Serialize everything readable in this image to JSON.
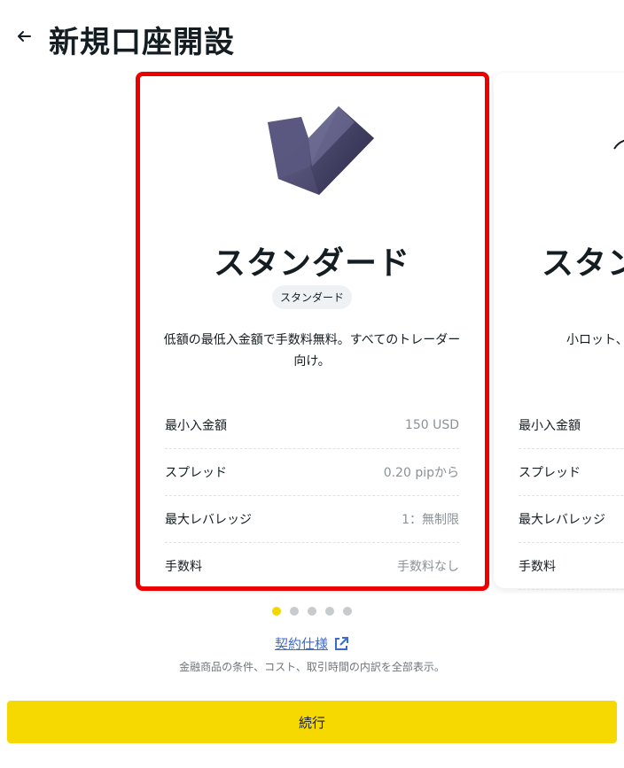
{
  "header": {
    "title": "新規口座開設",
    "back_icon": "arrow-left-icon"
  },
  "carousel": {
    "active_index": 0,
    "dot_count": 5,
    "cards": [
      {
        "title": "スタンダード",
        "badge": "スタンダード",
        "description": "低額の最低入金額で手数料無料。すべてのトレーダー向け。",
        "image": "standard-account-icon",
        "specs": [
          {
            "label": "最小入金額",
            "value": "150 USD"
          },
          {
            "label": "スプレッド",
            "value": "0.20 pipから"
          },
          {
            "label": "最大レバレッジ",
            "value": "1：無制限"
          },
          {
            "label": "手数料",
            "value": "手数料なし"
          }
        ]
      },
      {
        "title": "スタン",
        "description": "小ロット、",
        "specs": [
          {
            "label": "最小入金額"
          },
          {
            "label": "スプレッド"
          },
          {
            "label": "最大レバレッジ"
          },
          {
            "label": "手数料"
          }
        ]
      }
    ]
  },
  "spec_link": {
    "label": "契約仕様",
    "icon": "external-link-icon"
  },
  "spec_note": "金融商品の条件、コスト、取引時間の内訳を全部表示。",
  "continue_button": {
    "label": "続行"
  },
  "colors": {
    "accent": "#f6d900",
    "highlight": "#ed0000",
    "link": "#3c6bc8"
  }
}
